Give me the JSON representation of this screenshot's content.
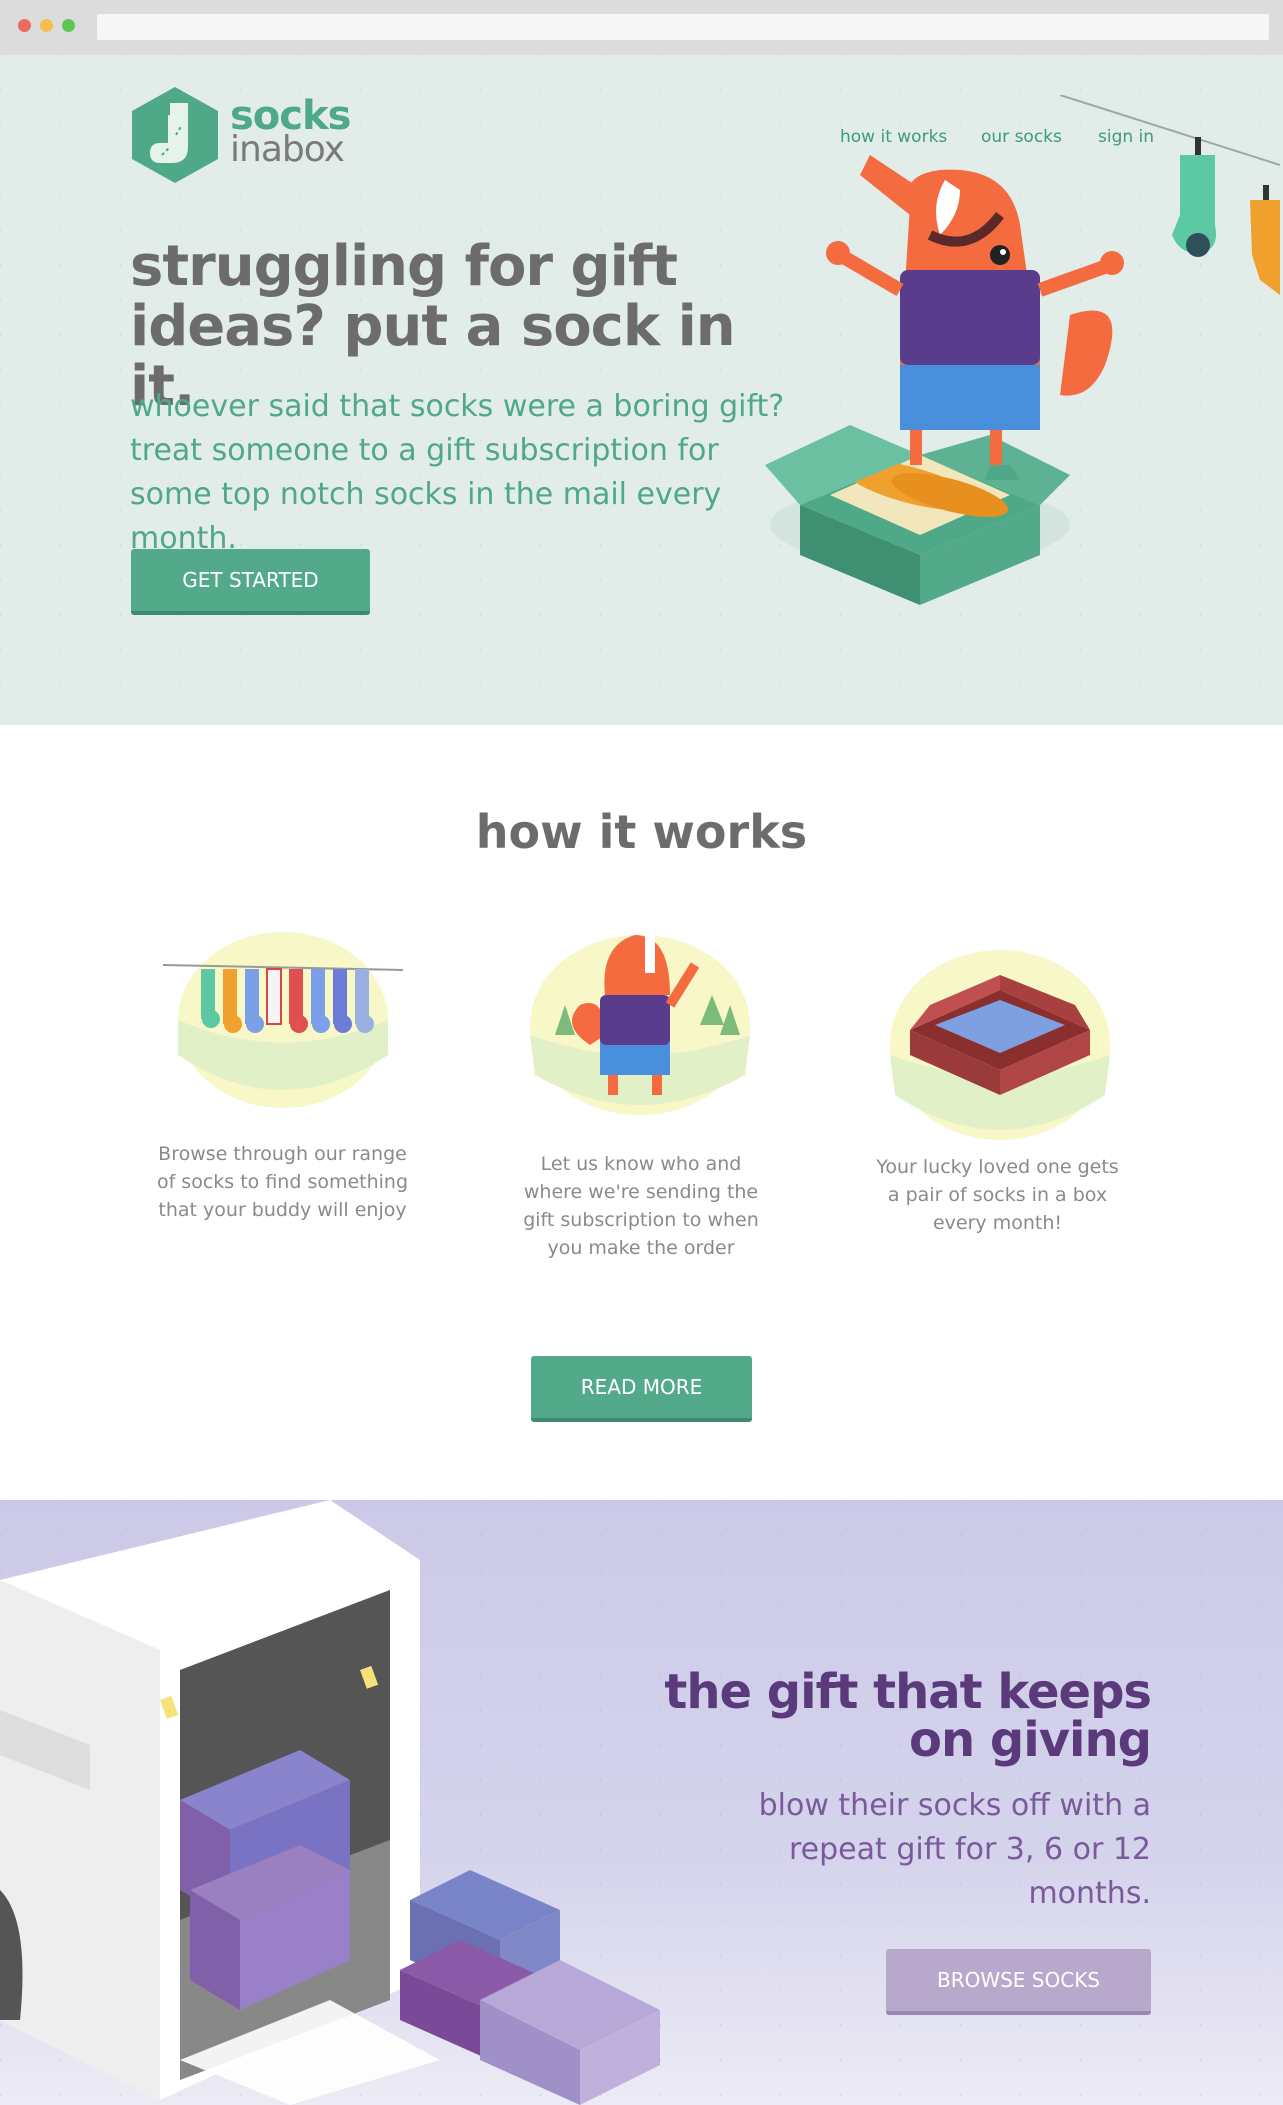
{
  "browser": {
    "dots": [
      "#ed6a5e",
      "#f5bf4f",
      "#61c554"
    ]
  },
  "header": {
    "logo_line1": "socks",
    "logo_line2": "inabox",
    "nav": [
      "how it works",
      "our socks",
      "sign in"
    ]
  },
  "hero": {
    "headline": "struggling for gift ideas? put a sock in it.",
    "subtext": "whoever said that socks were a boring gift? treat someone to a gift subscription for some top notch socks in the mail every month.",
    "cta": "GET STARTED"
  },
  "how_it_works": {
    "title": "how it works",
    "steps": [
      {
        "icon": "socks-clothesline-icon",
        "text": "Browse through our range of socks to find something that your buddy will enjoy"
      },
      {
        "icon": "beaver-waving-icon",
        "text": "Let us know who and where we're sending the gift subscription to when you make the order"
      },
      {
        "icon": "sock-box-icon",
        "text": "Your lucky loved one gets a pair of socks in a box every month!"
      }
    ],
    "cta": "READ MORE"
  },
  "gift": {
    "title": "the gift that keeps on giving",
    "subtext": "blow their socks off with a repeat gift for 3, 6 or 12 months.",
    "cta": "BROWSE SOCKS"
  },
  "colors": {
    "brand_green": "#52aa8a",
    "heading_gray": "#6c6c6c",
    "purple": "#5a3a7a"
  }
}
